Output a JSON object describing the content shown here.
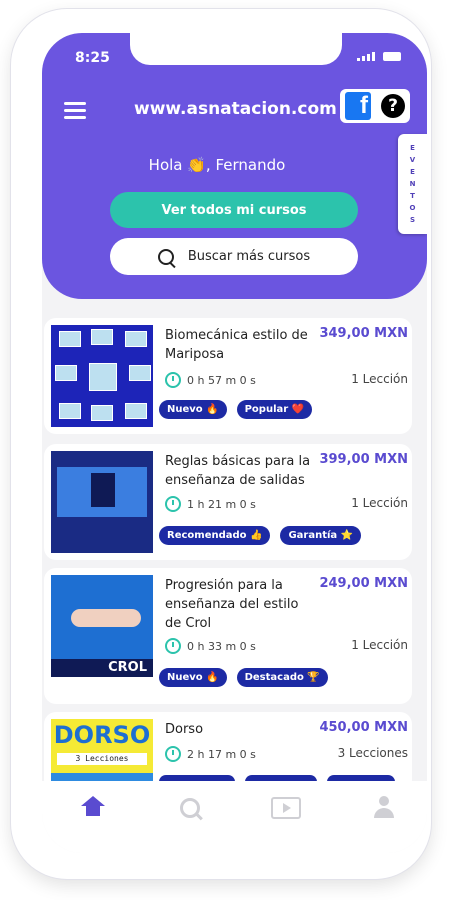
{
  "status": {
    "time": "8:25"
  },
  "header": {
    "site": "www.asnatacion.com",
    "facebook_letter": "f",
    "help_symbol": "?",
    "eventos_letters": [
      "E",
      "V",
      "E",
      "N",
      "T",
      "O",
      "S"
    ],
    "greeting": "Hola 👏, Fernando",
    "view_courses_label": "Ver todos mi cursos",
    "search_label": "Buscar más cursos"
  },
  "courses": [
    {
      "title": "Biomecánica estilo de Mariposa",
      "price": "349,00 MXN",
      "duration": "0 h 57 m 0 s",
      "lessons": "1 Lección",
      "badges": [
        "Nuevo 🔥",
        "Popular ❤️"
      ]
    },
    {
      "title": "Reglas básicas para la enseñanza de salidas",
      "price": "399,00 MXN",
      "duration": "1 h 21 m 0 s",
      "lessons": "1 Lección",
      "badges": [
        "Recomendado 👍",
        "Garantía ⭐"
      ]
    },
    {
      "title": "Progresión para la enseñanza del estilo de Crol",
      "price": "249,00 MXN",
      "duration": "0 h 33 m 0 s",
      "lessons": "1 Lección",
      "badges": [
        "Nuevo 🔥",
        "Destacado 🏆"
      ],
      "thumb_text": "CROL"
    },
    {
      "title": "Dorso",
      "price": "450,00 MXN",
      "duration": "2 h 17 m 0 s",
      "lessons": "3 Lecciones",
      "thumb_text": "DORSO",
      "thumb_subtext": "3 Lecciones"
    }
  ],
  "colors": {
    "primary": "#6b55e0",
    "accent": "#2cc3ac",
    "badge": "#1d2aa4",
    "price": "#5a4bd0"
  },
  "tabbar": {
    "icons": [
      "home-icon",
      "search-icon",
      "play-icon",
      "user-icon"
    ]
  }
}
